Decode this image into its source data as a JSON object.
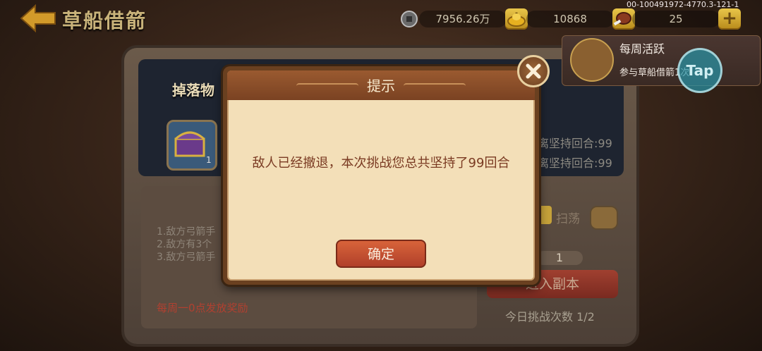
{
  "header": {
    "title": "草船借箭",
    "version": "00-100491972-4770.3-121-1"
  },
  "resources": [
    {
      "icon": "coin-icon",
      "value": "7956.26万"
    },
    {
      "icon": "gold-ingot-icon",
      "value": "10868"
    },
    {
      "icon": "stamina-meat-icon",
      "value": "25"
    }
  ],
  "plus_label": "+",
  "main": {
    "drop_banner": "掉落物",
    "chest_count": "1",
    "records": [
      "离坚持回合:99",
      "离坚持回合:99"
    ],
    "rules": [
      "1.敌方弓箭手",
      "2.敌方有3个",
      "3.敌方弓箭手"
    ],
    "weekly_reward": "每周一0点发放奖励",
    "sweep_label": "扫荡",
    "count_value": "1",
    "enter_button": "进入副本",
    "challenge_count": "今日挑战次数 1/2"
  },
  "notification": {
    "title": "每周活跃",
    "subtitle": "参与草船借箭1次",
    "tap_label": "Tap"
  },
  "dialog": {
    "title": "提示",
    "message": "敌人已经撤退，本次挑战您总共坚持了99回合",
    "confirm_label": "确定"
  },
  "colors": {
    "dialog_body": "#f3dfb8",
    "dialog_header": "#8a4e28",
    "confirm_button": "#c9503a",
    "message_text": "#7a3a22"
  }
}
